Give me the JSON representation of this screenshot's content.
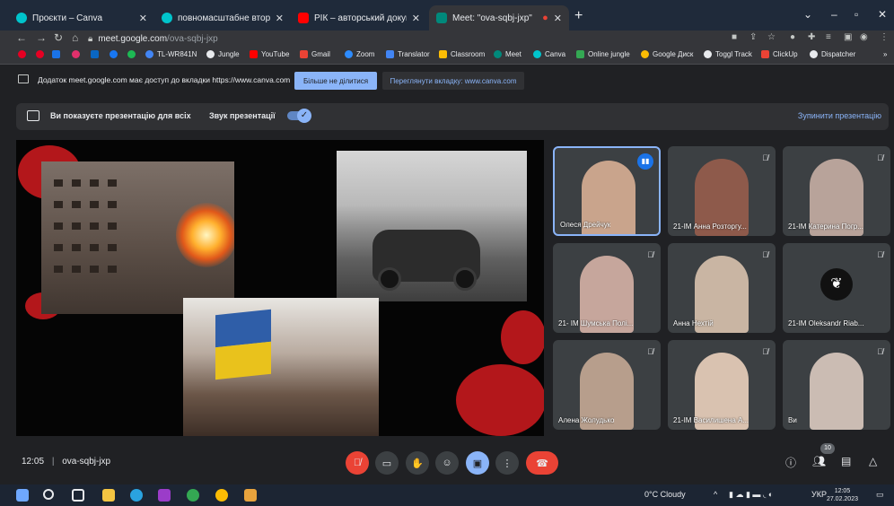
{
  "tabs": [
    {
      "title": "Проєкти – Canva",
      "color": "#00c4cc"
    },
    {
      "title": "повномасштабне вторгнен",
      "color": "#00c4cc"
    },
    {
      "title": "РІК – авторський документальн",
      "color": "#ff0000"
    },
    {
      "title": "Meet: \"ova-sqbj-jxp\"",
      "color": "#00897b",
      "active": true
    }
  ],
  "address": {
    "host": "meet.google.com",
    "path": "/ova-sqbj-jxp"
  },
  "bookmarks": [
    {
      "label": "",
      "color": "#e60023"
    },
    {
      "label": "",
      "color": "#e60023"
    },
    {
      "label": "",
      "color": "#1a73e8"
    },
    {
      "label": "",
      "color": "#e1306c"
    },
    {
      "label": "",
      "color": "#0a66c2"
    },
    {
      "label": "",
      "color": "#1877f2"
    },
    {
      "label": "",
      "color": "#1db954"
    },
    {
      "label": "TL-WR841N",
      "color": "#4285f4"
    },
    {
      "label": "Jungle",
      "color": "#e8eaed"
    },
    {
      "label": "YouTube",
      "color": "#ff0000"
    },
    {
      "label": "Gmail",
      "color": "#ea4335"
    },
    {
      "label": "Zoom",
      "color": "#2d8cff"
    },
    {
      "label": "Translator",
      "color": "#4285f4"
    },
    {
      "label": "Classroom",
      "color": "#fbbc04"
    },
    {
      "label": "Meet",
      "color": "#00897b"
    },
    {
      "label": "Canva",
      "color": "#00c4cc"
    },
    {
      "label": "Online jungle",
      "color": "#34a853"
    },
    {
      "label": "Google Диск",
      "color": "#fbbc04"
    },
    {
      "label": "Toggl Track",
      "color": "#e8eaed"
    },
    {
      "label": "ClickUp",
      "color": "#ea4335"
    },
    {
      "label": "Dispatcher",
      "color": "#e8eaed"
    }
  ],
  "share_bar": {
    "text": "Додаток meet.google.com має доступ до вкладки https://www.canva.com",
    "stop_label": "Більше не ділитися",
    "view_label": "Переглянути вкладку: www.canva.com"
  },
  "presenting": {
    "text": "Ви показуєте презентацію для всіх",
    "sound_label": "Звук презентації",
    "stop_label": "Зупинити презентацію"
  },
  "participants": [
    {
      "name": "Олеся Дрейчук",
      "bg": "#c9a48c",
      "speaking": true
    },
    {
      "name": "21-ІМ Анна Розторгу...",
      "bg": "#8e5a4b"
    },
    {
      "name": "21-ІМ Катерина Погр...",
      "bg": "#b8a39a"
    },
    {
      "name": "21- ІМ Шумська Полі...",
      "bg": "#c6a69c"
    },
    {
      "name": "Анна Нехтій",
      "bg": "#c9b5a3"
    },
    {
      "name": "21-ІМ Oleksandr Riab...",
      "bg": "#3c4043",
      "avatar": true
    },
    {
      "name": "Алена Жолудько",
      "bg": "#b79e8c"
    },
    {
      "name": "21-ІМ Василишена А...",
      "bg": "#d9c2b0"
    },
    {
      "name": "Ви",
      "bg": "#cbbcb3"
    }
  ],
  "meeting": {
    "time": "12:05",
    "code": "ova-sqbj-jxp",
    "participant_count": "10"
  },
  "taskbar": {
    "weather": "0°C Cloudy",
    "lang": "УКР",
    "time": "12:05",
    "date": "27.02.2023"
  }
}
